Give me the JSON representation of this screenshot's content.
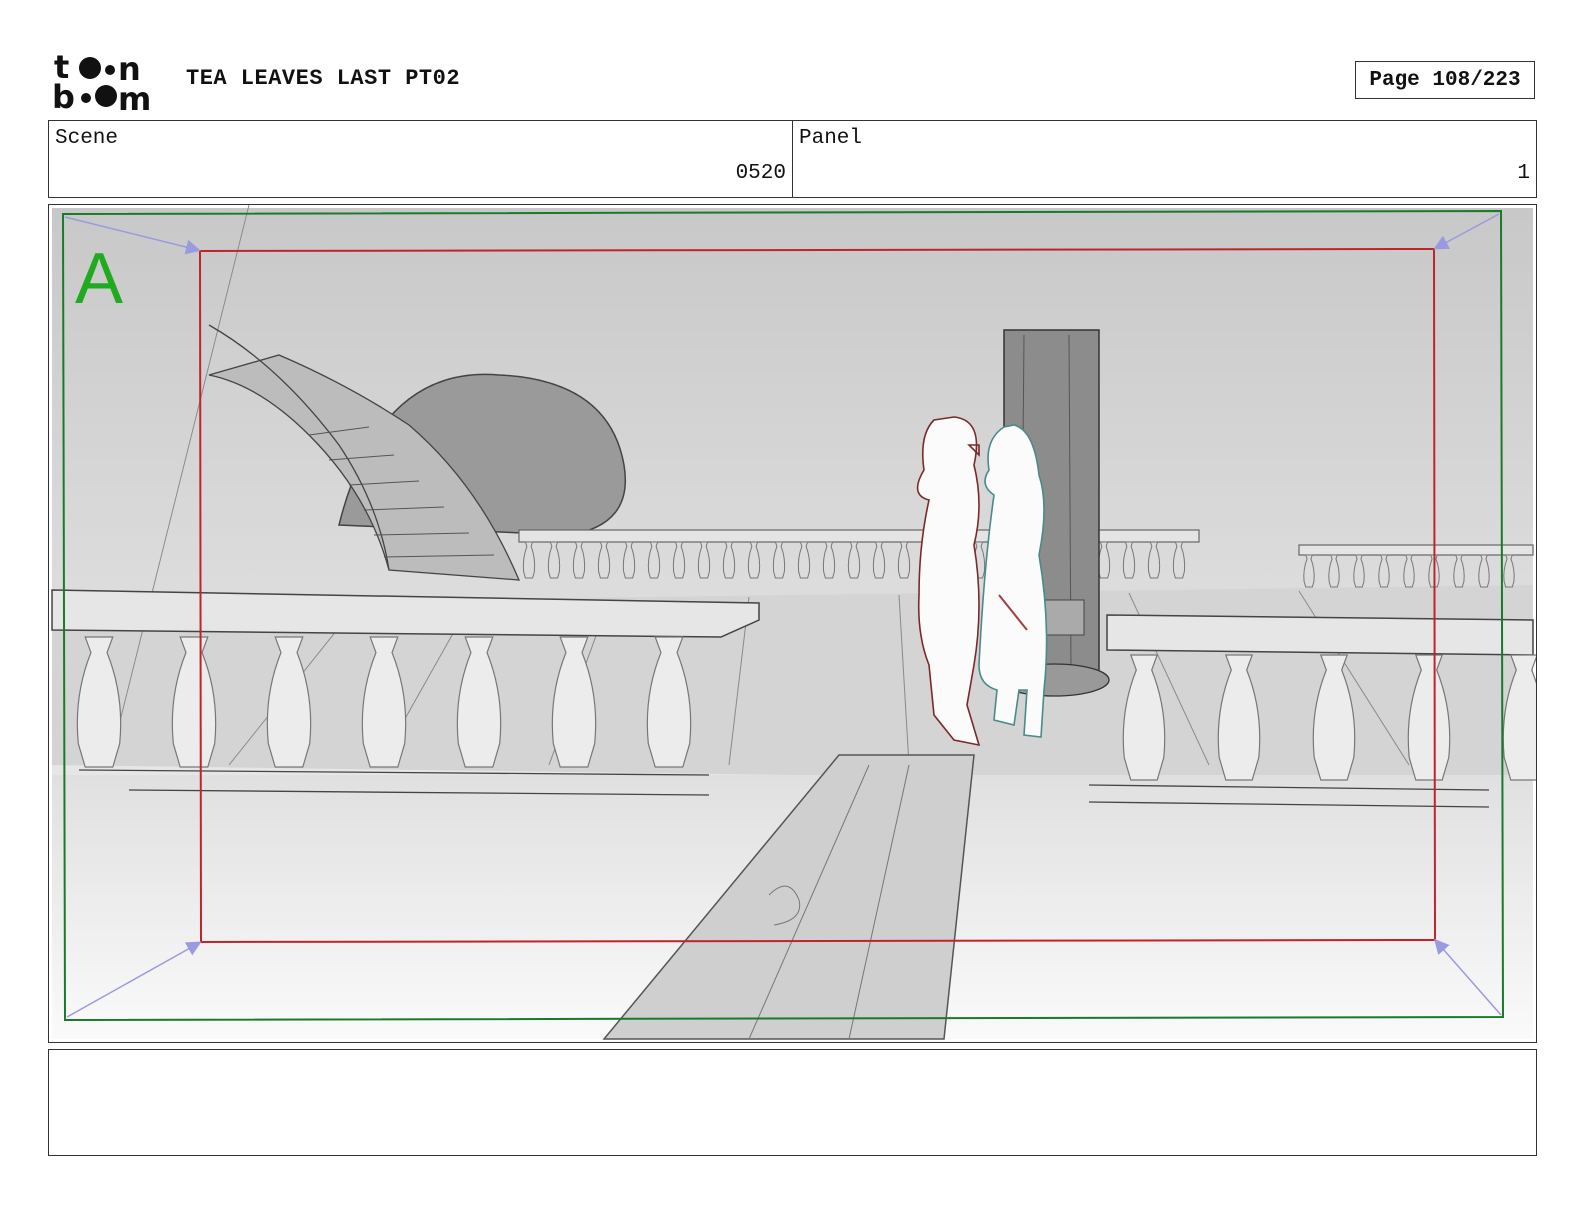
{
  "header": {
    "logo_alt": "toon boom",
    "project_title": "TEA LEAVES LAST PT02",
    "page_label": "Page 108/223"
  },
  "info": {
    "scene_label": "Scene",
    "scene_value": "0520",
    "panel_label": "Panel",
    "panel_value": "1"
  },
  "panel": {
    "layer_letter": "A",
    "colors": {
      "safe_frame": "#1a7a2a",
      "camera_frame": "#c0242a",
      "arrows": "#9a9ae0",
      "layer_letter": "#1faa1f",
      "character_left": "#7a2a2a",
      "character_right": "#4a8a8a"
    }
  },
  "notes": {
    "text": ""
  }
}
